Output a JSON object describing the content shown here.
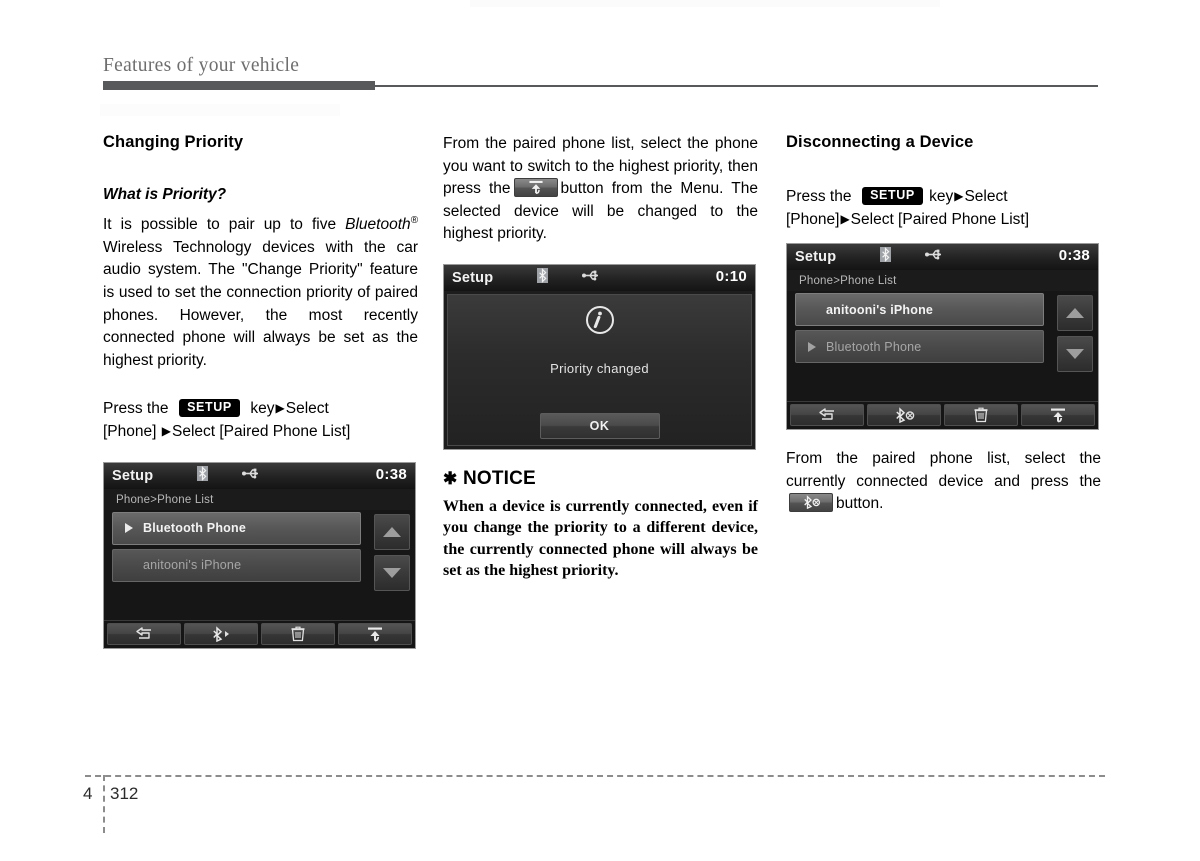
{
  "header": {
    "title": "Features of your vehicle"
  },
  "footer": {
    "chapter": "4",
    "page": "312"
  },
  "col1": {
    "section_title": "Changing Priority",
    "sub_title": "What is Priority?",
    "para_1_a": "It is possible to pair up to five ",
    "para_1_bt": "Bluetooth",
    "para_1_reg": "®",
    "para_1_b": " Wireless Technology devices with the car audio system. The \"Change Priority\" feature is used to set the connection priority of paired phones. However, the most recently connected phone will always be set as the highest priority.",
    "instr_press": "Press   the",
    "instr_key": "SETUP",
    "instr_after": "key",
    "instr_arrow": "▶",
    "instr_select": "Select",
    "instr_line2_phone": "[Phone]",
    "instr_line2_arrow": "▶",
    "instr_line2_rest": "Select [Paired Phone List]"
  },
  "col2": {
    "para_1_a": "From the paired phone list, select the phone you want to switch to the highest priority, then press the",
    "para_1_b": "button from the Menu. The selected device will be changed to the highest priority.",
    "notice_star": "✱",
    "notice_title": "NOTICE",
    "notice_body": "When a device is currently connected, even if you change the priority to a different device, the currently connected phone will always be set as the highest priority."
  },
  "col3": {
    "section_title": "Disconnecting a Device",
    "instr_press": "Press     the",
    "instr_key": "SETUP",
    "instr_after": "key",
    "instr_arrow": "▶",
    "instr_select": "Select",
    "instr_line2_phone": "[Phone]",
    "instr_line2_arrow": "▶",
    "instr_line2_rest": "Select [Paired Phone List]",
    "para_after_a": "From the paired phone list, select the currently connected device and press the",
    "para_after_b": "button."
  },
  "screens": [
    {
      "id": "phone-list-before",
      "title": "Setup",
      "clock": "0:38",
      "breadcrumb": "Phone>Phone List",
      "status_icons": [
        "bluetooth-icon",
        "usb-icon"
      ],
      "rows": [
        {
          "label": "Bluetooth Phone",
          "state": "bright",
          "marker": "play-triangle"
        },
        {
          "label": "anitooni's iPhone",
          "state": "dim",
          "marker": "none"
        }
      ],
      "scroll": [
        "scroll-up-icon",
        "scroll-down-icon"
      ],
      "toolbar": [
        "back-icon",
        "bluetooth-connect-icon",
        "delete-icon",
        "priority-up-icon"
      ]
    },
    {
      "id": "priority-changed-dialog",
      "title": "Setup",
      "clock": "0:10",
      "status_icons": [
        "bluetooth-icon",
        "usb-icon"
      ],
      "dialog_icon": "info-icon",
      "message": "Priority changed",
      "ok_label": "OK"
    },
    {
      "id": "phone-list-after",
      "title": "Setup",
      "clock": "0:38",
      "breadcrumb": "Phone>Phone List",
      "status_icons": [
        "bluetooth-icon",
        "usb-icon"
      ],
      "rows": [
        {
          "label": "anitooni's iPhone",
          "state": "bright",
          "marker": "none"
        },
        {
          "label": "Bluetooth Phone",
          "state": "dim",
          "marker": "play-triangle"
        }
      ],
      "scroll": [
        "scroll-up-icon",
        "scroll-down-icon"
      ],
      "toolbar": [
        "back-icon",
        "bluetooth-disconnect-icon",
        "delete-icon",
        "priority-up-icon"
      ]
    }
  ]
}
